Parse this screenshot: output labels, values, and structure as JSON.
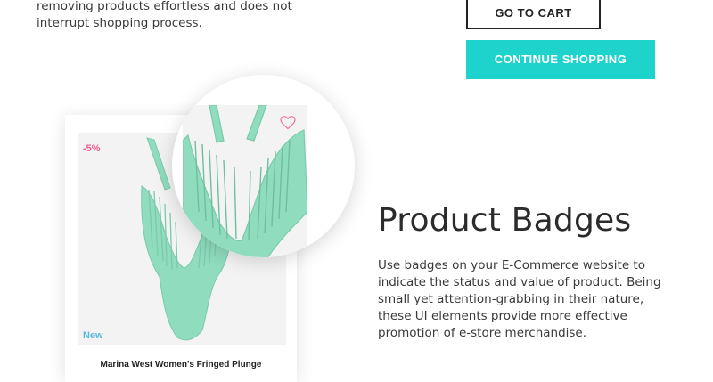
{
  "intro": {
    "text": "removing products effortless and does not interrupt shopping process."
  },
  "buttons": {
    "go_to_cart": "GO TO CART",
    "continue_shopping": "CONTINUE SHOPPING"
  },
  "product": {
    "sale_badge": "-5%",
    "new_badge": "New",
    "name": "Marina West Women's Fringed Plunge",
    "wishlist_icon": "heart-icon"
  },
  "section": {
    "title": "Product Badges",
    "description": "Use badges on your E-Commerce website to indicate the status and value of product. Being small yet attention-grabbing in their nature, these UI elements provide more effective promotion of e-store merchandise."
  },
  "colors": {
    "accent_teal": "#1dd3cc",
    "sale_pink": "#f25b8a",
    "new_blue": "#58b8d8",
    "swimsuit": "#8fdcbf",
    "heart": "#f07aa0"
  }
}
